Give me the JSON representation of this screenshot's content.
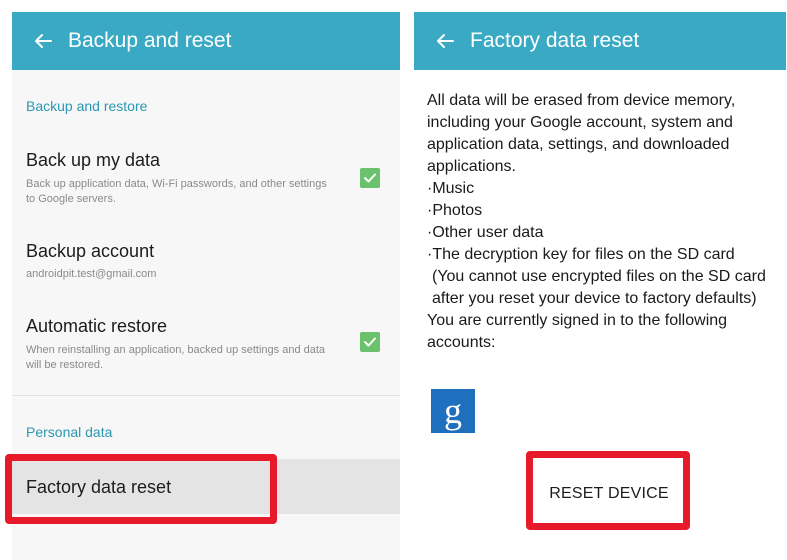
{
  "left_screen": {
    "title": "Backup and reset",
    "sections": {
      "backup_restore": "Backup and restore",
      "personal_data": "Personal data"
    },
    "items": {
      "backup_data": {
        "primary": "Back up my data",
        "secondary": "Back up application data, Wi-Fi passwords, and other settings to Google servers.",
        "checked": true
      },
      "backup_account": {
        "primary": "Backup account",
        "secondary": "androidpit.test@gmail.com"
      },
      "auto_restore": {
        "primary": "Automatic restore",
        "secondary": "When reinstalling an application, backed up settings and data will be restored.",
        "checked": true
      },
      "factory_reset": {
        "primary": "Factory data reset"
      }
    }
  },
  "right_screen": {
    "title": "Factory data reset",
    "intro": "All data will be erased from device memory, including your Google account, system and application data, settings, and downloaded applications.",
    "list": [
      "·Music",
      "·Photos",
      "·Other user data",
      "·The decryption key for files on the SD card"
    ],
    "sd_note": "(You cannot use encrypted files on the SD card after you reset your device to factory defaults)",
    "signed_in": "You are currently signed in to the following accounts:",
    "account_icon_letter": "g",
    "reset_button": "RESET DEVICE"
  },
  "colors": {
    "app_bar": "#3aa9c4",
    "section_header": "#2a98b4",
    "checkbox": "#6cc26c",
    "highlight_box": "#e8192b",
    "google_icon_bg": "#1f6fbf"
  },
  "icons": {
    "back": "arrow-left",
    "check": "checkmark",
    "account": "google-g"
  }
}
